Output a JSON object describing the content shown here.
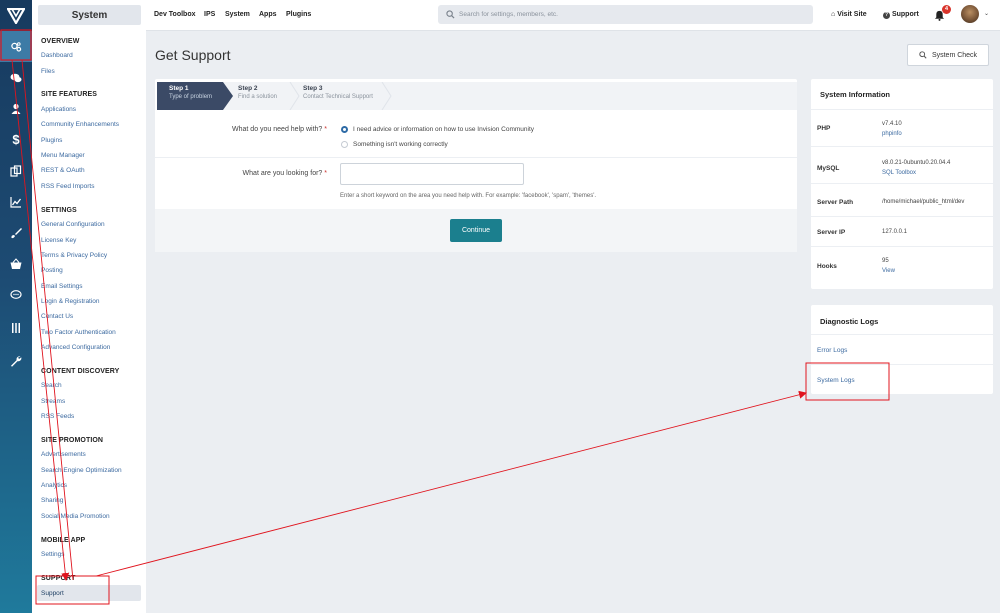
{
  "sidebar": {
    "title": "System",
    "sections": [
      {
        "heading": "OVERVIEW",
        "items": [
          "Dashboard",
          "Files"
        ]
      },
      {
        "heading": "SITE FEATURES",
        "items": [
          "Applications",
          "Community Enhancements",
          "Plugins",
          "Menu Manager",
          "REST & OAuth",
          "RSS Feed Imports"
        ]
      },
      {
        "heading": "SETTINGS",
        "items": [
          "General Configuration",
          "License Key",
          "Terms & Privacy Policy",
          "Posting",
          "Email Settings",
          "Login & Registration",
          "Contact Us",
          "Two Factor Authentication",
          "Advanced Configuration"
        ]
      },
      {
        "heading": "CONTENT DISCOVERY",
        "items": [
          "Search",
          "Streams",
          "RSS Feeds"
        ]
      },
      {
        "heading": "SITE PROMOTION",
        "items": [
          "Advertisements",
          "Search Engine Optimization",
          "Analytics",
          "Sharing",
          "Social Media Promotion"
        ]
      },
      {
        "heading": "MOBILE APP",
        "items": [
          "Settings"
        ]
      },
      {
        "heading": "SUPPORT",
        "items": [
          "Support"
        ]
      }
    ]
  },
  "iconbar": {
    "items": [
      "system-icon",
      "chat-icon",
      "user-icon",
      "dollar-icon",
      "copy-icon",
      "chart-icon",
      "brush-icon",
      "basket-icon",
      "comment-icon",
      "columns-icon",
      "wrench-icon"
    ]
  },
  "topbar": {
    "links": [
      "Dev Toolbox",
      "IPS",
      "System",
      "Apps",
      "Plugins"
    ],
    "search_placeholder": "Search for settings, members, etc.",
    "visit_site": "Visit Site",
    "support": "Support",
    "notification_count": "4"
  },
  "page": {
    "title": "Get Support",
    "system_check": "System Check"
  },
  "steps": [
    {
      "title": "Step 1",
      "subtitle": "Type of problem"
    },
    {
      "title": "Step 2",
      "subtitle": "Find a solution"
    },
    {
      "title": "Step 3",
      "subtitle": "Contact Technical Support"
    }
  ],
  "form": {
    "help_label": "What do you need help with?",
    "options": [
      "I need advice or information on how to use Invision Community",
      "Something isn't working correctly"
    ],
    "selected_option": 0,
    "keyword_label": "What are you looking for?",
    "keyword_value": "",
    "keyword_help": "Enter a short keyword on the area you need help with. For example: 'facebook', 'spam', 'themes'.",
    "continue": "Continue"
  },
  "system_info": {
    "title": "System Information",
    "rows": [
      {
        "key": "PHP",
        "value": "v7.4.10",
        "link": "phpinfo"
      },
      {
        "key": "MySQL",
        "value": "v8.0.21-0ubuntu0.20.04.4",
        "link": "SQL Toolbox"
      },
      {
        "key": "Server Path",
        "value": "/home/michael/public_html/dev",
        "link": ""
      },
      {
        "key": "Server IP",
        "value": "127.0.0.1",
        "link": ""
      },
      {
        "key": "Hooks",
        "value": "95",
        "link": "View"
      }
    ]
  },
  "diagnostic_logs": {
    "title": "Diagnostic Logs",
    "items": [
      "Error Logs",
      "System Logs"
    ]
  },
  "colors": {
    "accent": "#1b7f8e",
    "annotation": "#e0141e",
    "sidebar_dark": "#173a5e",
    "step_active": "#3b4a66"
  }
}
